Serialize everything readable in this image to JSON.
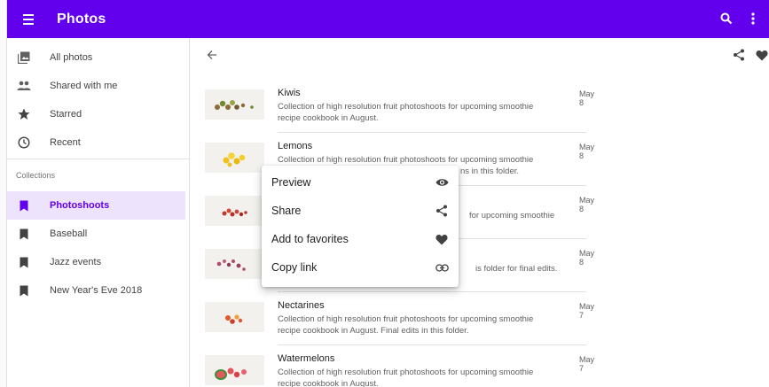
{
  "app": {
    "title": "Photos"
  },
  "drawer": {
    "items": [
      {
        "label": "All photos",
        "icon": "photo-library-icon"
      },
      {
        "label": "Shared with me",
        "icon": "people-icon"
      },
      {
        "label": "Starred",
        "icon": "star-icon"
      },
      {
        "label": "Recent",
        "icon": "clock-icon"
      }
    ],
    "section_label": "Collections",
    "collections": [
      {
        "label": "Photoshoots",
        "icon": "bookmark-icon",
        "active": true
      },
      {
        "label": "Baseball",
        "icon": "bookmark-icon"
      },
      {
        "label": "Jazz events",
        "icon": "bookmark-icon"
      },
      {
        "label": "New Year's Eve 2018",
        "icon": "bookmark-icon"
      }
    ]
  },
  "list": {
    "rows": [
      {
        "title": "Kiwis",
        "desc_line1": "Collection of high resolution fruit photoshoots for upcoming smoothie",
        "desc_line2": "recipe cookbook in August.",
        "date": "May 8"
      },
      {
        "title": "Lemons",
        "desc_line1": "Collection of high resolution fruit photoshoots for upcoming smoothie",
        "desc_line2": "ns in this folder.",
        "date": "May 8"
      },
      {
        "title": "",
        "desc_line1": "for upcoming smoothie",
        "desc_line2": "",
        "date": "May 8"
      },
      {
        "title": "",
        "desc_line1": "is folder for final edits.",
        "desc_line2": "",
        "date": "May 8"
      },
      {
        "title": "Nectarines",
        "desc_line1": "Collection of high resolution fruit photoshoots for upcoming smoothie",
        "desc_line2": "recipe cookbook in August. Final edits in this folder.",
        "date": "May 7"
      },
      {
        "title": "Watermelons",
        "desc_line1": "Collection of high resolution fruit photoshoots for upcoming smoothie",
        "desc_line2": "recipe cookbook in August.",
        "date": "May 7"
      }
    ]
  },
  "context_menu": {
    "items": [
      {
        "label": "Preview",
        "icon": "eye-icon"
      },
      {
        "label": "Share",
        "icon": "share-icon"
      },
      {
        "label": "Add to favorites",
        "icon": "heart-icon"
      },
      {
        "label": "Copy link",
        "icon": "link-icon"
      }
    ]
  },
  "colors": {
    "primary": "#6200ee",
    "active_bg": "#ede3fc"
  }
}
